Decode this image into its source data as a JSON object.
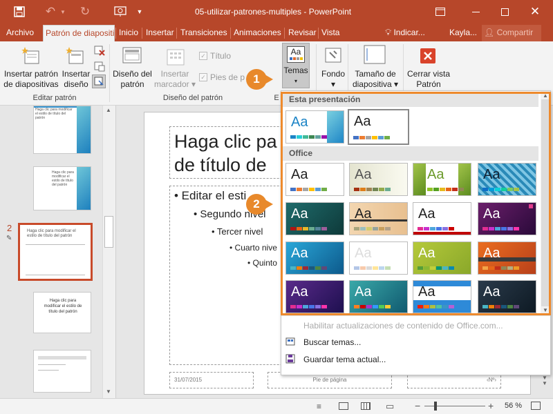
{
  "titlebar": {
    "doc_title": "05-utilizar-patrones-multiples - PowerPoint",
    "user": "Kayla...",
    "share": "Compartir",
    "tell_me": "Indicar..."
  },
  "tabs": [
    "Archivo",
    "Patrón de diapositi",
    "Inicio",
    "Insertar",
    "Transiciones",
    "Animaciones",
    "Revisar",
    "Vista"
  ],
  "ribbon": {
    "insert_master": "Insertar patrón de diapositivas",
    "insert_layout": "Insertar diseño",
    "group_edit": "Editar patrón",
    "master_layout": "Diseño del patrón",
    "insert_placeholder": "Insertar marcador",
    "title_cb": "Título",
    "footers_cb": "Pies de p",
    "group_layout": "Diseño del patrón",
    "group_e": "E",
    "themes": "Temas",
    "background": "Fondo",
    "slide_size": "Tamaño de diapositiva",
    "close_view": "Cerrar vista Patrón"
  },
  "thumbs": {
    "number": "2",
    "t1": "Haga clic para modificar el estilo de título del patrón",
    "t2": "Haga clic para modificar el estilo de título del patrón",
    "t3": "Haga clic para modificar el estilo de título del patrón",
    "t4": "Haga clic para modificar el estilo de título del patrón"
  },
  "slide": {
    "title_l1": "Haga clic pa",
    "title_l2": "de título de",
    "b1": "• Editar el esti",
    "b2": "• Segundo nivel",
    "b3": "• Tercer nivel",
    "b4": "• Cuarto nive",
    "b5": "• Quinto",
    "date": "31/07/2015",
    "footer": "Pie de página",
    "num": "‹Nº›"
  },
  "gallery": {
    "section1": "Esta presentación",
    "section2": "Office",
    "aa": "Aa",
    "menu_update": "Habilitar actualizaciones de contenido de Office.com...",
    "menu_browse": "Buscar temas...",
    "menu_save": "Guardar tema actual..."
  },
  "callouts": [
    "1",
    "2"
  ],
  "status": {
    "zoom": "56 %"
  },
  "colors": {
    "accent": "#b7472a",
    "callout": "#e8892b"
  }
}
